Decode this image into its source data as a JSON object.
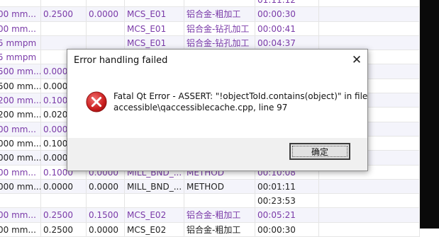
{
  "background_table": {
    "rows": [
      {
        "cells": [
          "",
          "",
          "",
          "",
          "",
          "01:11:12",
          ""
        ],
        "alt": false
      },
      {
        "cells": [
          "00 mm...",
          "0.2500",
          "0.0000",
          "MCS_E01",
          "铝合金-粗加工",
          "00:00:30",
          ""
        ],
        "alt": true
      },
      {
        "cells": [
          "00 mm...",
          "",
          "",
          "MCS_E01",
          "铝合金-钻孔加工",
          "00:00:41",
          ""
        ],
        "alt": false
      },
      {
        "cells": [
          "5 mmpm",
          "",
          "",
          "MCS_E01",
          "铝合金-钻孔加工",
          "00:04:37",
          ""
        ],
        "alt": true
      },
      {
        "cells": [
          "5 mmpm",
          "",
          "",
          "",
          "",
          "",
          ""
        ],
        "alt": false
      },
      {
        "cells": [
          "500 mm...",
          "0.000",
          "",
          "",
          "",
          "",
          ""
        ],
        "alt": true
      },
      {
        "cells": [
          "500 mm...",
          "0.000",
          "",
          "",
          "",
          "",
          ""
        ],
        "alt": false
      },
      {
        "cells": [
          "200 mm...",
          "0.100",
          "",
          "",
          "",
          "",
          ""
        ],
        "alt": true
      },
      {
        "cells": [
          "200 mm...",
          "0.020",
          "",
          "",
          "",
          "",
          ""
        ],
        "alt": false
      },
      {
        "cells": [
          "00 mm...",
          "0.000",
          "",
          "",
          "",
          "",
          ""
        ],
        "alt": true
      },
      {
        "cells": [
          "000 mm...",
          "0.100",
          "",
          "",
          "",
          "",
          ""
        ],
        "alt": false
      },
      {
        "cells": [
          "000 mm...",
          "0.000",
          "",
          "",
          "",
          "",
          ""
        ],
        "alt": true
      },
      {
        "cells": [
          "00 mm...",
          "0.1000",
          "0.0000",
          "MILL_BND_...",
          "METHOD",
          "00:10:08",
          ""
        ],
        "alt": false
      },
      {
        "cells": [
          "000 mm...",
          "0.0000",
          "0.0000",
          "MILL_BND_...",
          "METHOD",
          "00:01:11",
          ""
        ],
        "alt": true
      },
      {
        "cells": [
          "",
          "",
          "",
          "",
          "",
          "00:23:53",
          ""
        ],
        "alt": false
      },
      {
        "cells": [
          "00 mm...",
          "0.2500",
          "0.1500",
          "MCS_E02",
          "铝合金-粗加工",
          "00:05:21",
          ""
        ],
        "alt": true
      },
      {
        "cells": [
          "00 mm...",
          "0.2500",
          "0.0000",
          "MCS_E02",
          "铝合金-粗加工",
          "00:00:30",
          ""
        ],
        "alt": false
      }
    ],
    "cell_colors": [
      [
        "",
        "",
        "",
        "",
        "",
        "purple",
        ""
      ],
      [
        "purple",
        "purple",
        "purple",
        "purple",
        "purple",
        "purple",
        ""
      ],
      [
        "purple",
        "",
        "",
        "purple",
        "purple",
        "purple",
        ""
      ],
      [
        "purple",
        "",
        "",
        "purple",
        "purple",
        "purple",
        ""
      ],
      [
        "purple",
        "",
        "",
        "",
        "",
        "",
        ""
      ],
      [
        "purple",
        "purple",
        "",
        "",
        "",
        "",
        ""
      ],
      [
        "dark",
        "dark",
        "",
        "",
        "",
        "",
        ""
      ],
      [
        "purple",
        "purple",
        "",
        "",
        "",
        "",
        ""
      ],
      [
        "dark",
        "dark",
        "",
        "",
        "",
        "",
        ""
      ],
      [
        "purple",
        "purple",
        "",
        "",
        "",
        "",
        ""
      ],
      [
        "dark",
        "dark",
        "",
        "",
        "",
        "",
        ""
      ],
      [
        "dark",
        "dark",
        "",
        "",
        "",
        "",
        ""
      ],
      [
        "purple",
        "purple",
        "purple",
        "purple",
        "purple",
        "purple",
        ""
      ],
      [
        "dark",
        "dark",
        "dark",
        "dark",
        "dark",
        "dark",
        ""
      ],
      [
        "",
        "",
        "",
        "",
        "",
        "dark",
        ""
      ],
      [
        "purple",
        "purple",
        "purple",
        "purple",
        "purple",
        "purple",
        ""
      ],
      [
        "dark",
        "dark",
        "dark",
        "dark",
        "dark",
        "dark",
        ""
      ]
    ]
  },
  "dialog": {
    "title": "Error handling failed",
    "close_icon": "close-icon",
    "error_icon": "error-icon",
    "message_line1": "Fatal Qt Error - ASSERT: \"!objectToId.contains(object)\" in file",
    "message_line2": "accessible\\qaccessiblecache.cpp, line 97",
    "ok_label": "确定"
  },
  "colors": {
    "purple_text": "#7a3aa8",
    "dark_text": "#222222",
    "error_red": "#d42a2a",
    "dialog_footer": "#f0f0f0"
  }
}
